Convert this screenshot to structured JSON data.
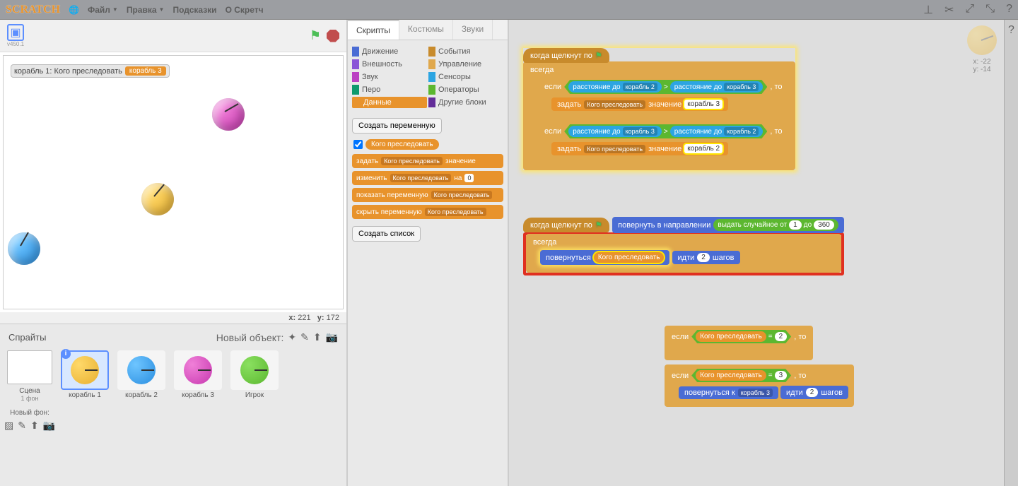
{
  "menubar": {
    "logo": "SCRATCH",
    "file": "Файл",
    "edit": "Правка",
    "tips": "Подсказки",
    "about": "О Скретч"
  },
  "stage": {
    "version": "v450.1",
    "var_display_name": "корабль 1: Кого преследовать",
    "var_display_value": "корабль 3",
    "coords_x_label": "x:",
    "coords_x": "221",
    "coords_y_label": "y:",
    "coords_y": "172"
  },
  "sprites_panel": {
    "title": "Спрайты",
    "new_object": "Новый объект:",
    "scene_label": "Сцена",
    "scene_sub": "1 фон",
    "new_bg": "Новый фон:",
    "sprites": [
      {
        "name": "корабль 1"
      },
      {
        "name": "корабль 2"
      },
      {
        "name": "корабль 3"
      },
      {
        "name": "Игрок"
      }
    ]
  },
  "tabs": {
    "scripts": "Скрипты",
    "costumes": "Костюмы",
    "sounds": "Звуки"
  },
  "categories": {
    "motion": "Движение",
    "events": "События",
    "looks": "Внешность",
    "control": "Управление",
    "sound": "Звук",
    "sensing": "Сенсоры",
    "pen": "Перо",
    "operators": "Операторы",
    "data": "Данные",
    "more": "Другие блоки"
  },
  "palette": {
    "create_var": "Создать переменную",
    "var_name": "Кого преследовать",
    "set": "задать",
    "set_value": "значение",
    "change": "изменить",
    "change_by": "на",
    "change_by_val": "0",
    "show_var": "показать переменную",
    "hide_var": "скрыть переменную",
    "create_list": "Создать список"
  },
  "scripts": {
    "when_flag": "когда щелкнут по",
    "forever": "всегда",
    "if": "если",
    "then": ", то",
    "distance_to": "расстояние до",
    "ship2": "корабль 2",
    "ship3": "корабль 3",
    "gt": ">",
    "eq": "=",
    "set": "задать",
    "set_val": "значение",
    "var_name": "Кого преследовать",
    "point_dir": "повернуть в направлении",
    "random": "выдать случайное от",
    "random_to": "до",
    "rand_min": "1",
    "rand_max": "360",
    "point_towards": "повернуться",
    "point_towards_k": "повернуться к",
    "move": "идти",
    "move_steps": "шагов",
    "move_val": "2",
    "val_2": "2",
    "val_3": "3"
  },
  "preview": {
    "x_label": "x:",
    "x": "-22",
    "y_label": "y:",
    "y": "-14"
  }
}
